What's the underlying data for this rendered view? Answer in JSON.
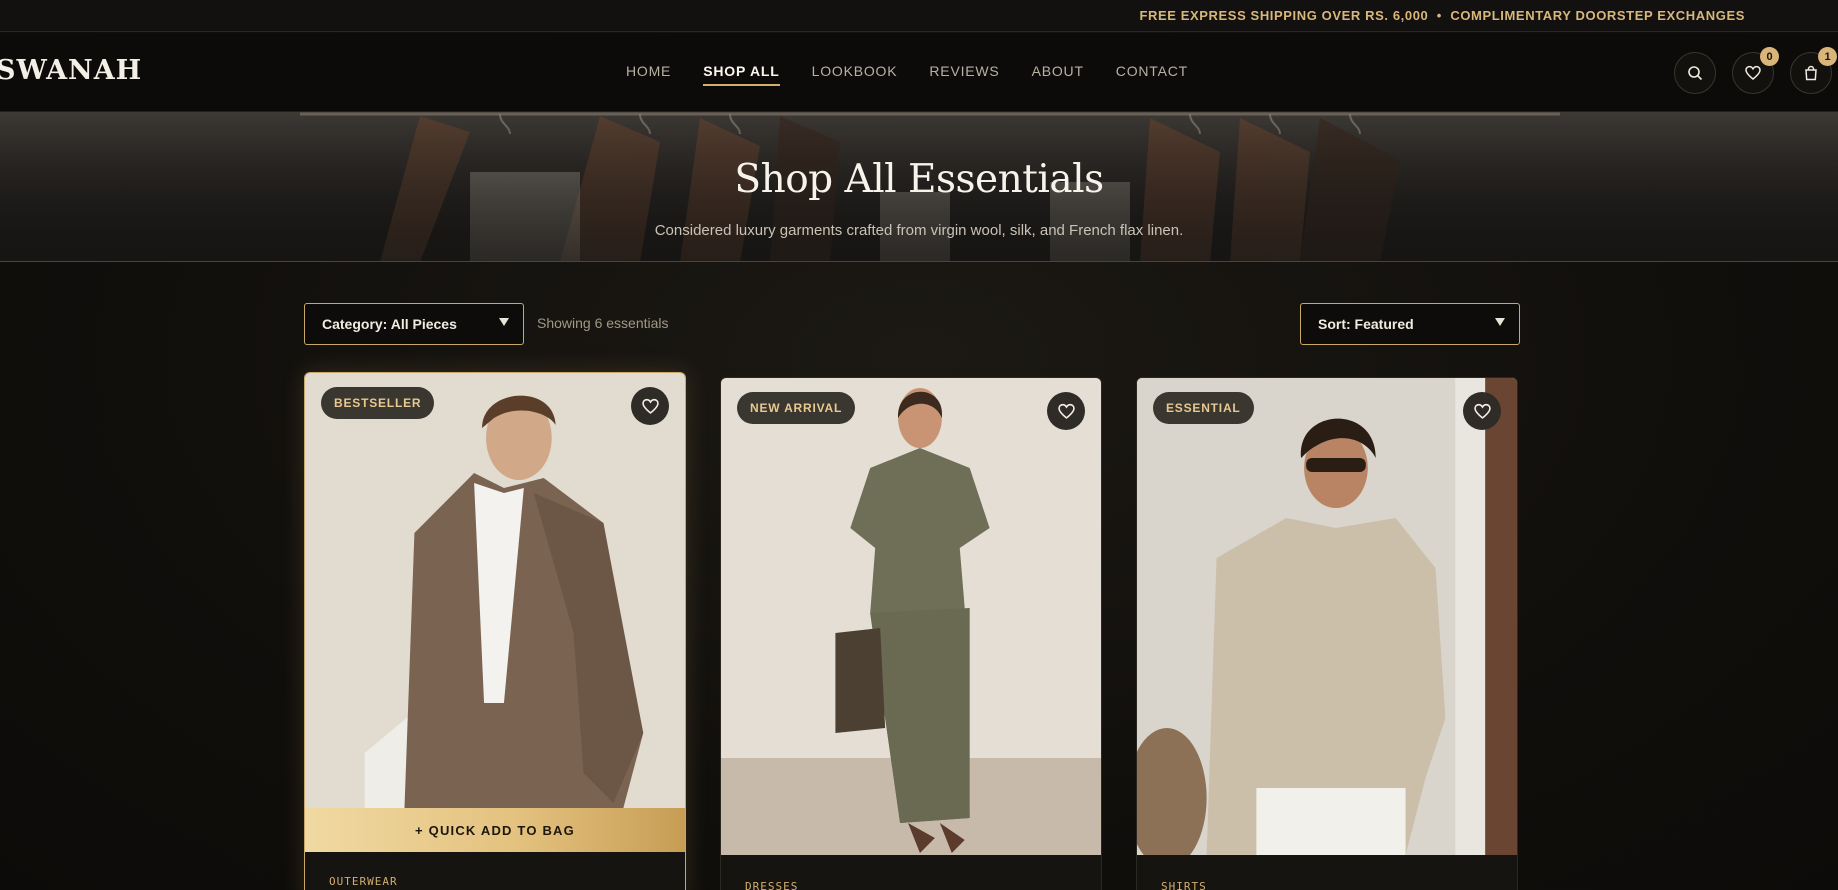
{
  "announcement": "FREE EXPRESS SHIPPING OVER RS. 6,000  •  COMPLIMENTARY DOORSTEP EXCHANGES",
  "header": {
    "logo": "SWANAH",
    "nav": [
      "HOME",
      "SHOP ALL",
      "LOOKBOOK",
      "REVIEWS",
      "ABOUT",
      "CONTACT"
    ],
    "active_nav": "SHOP ALL",
    "wishlist_count": "0",
    "cart_count": "1"
  },
  "hero": {
    "title": "Shop All Essentials",
    "subtitle": "Considered luxury garments crafted from virgin wool, silk, and French flax linen."
  },
  "toolbar": {
    "category_label": "Category: All Pieces",
    "count_text": "Showing 6 essentials",
    "sort_label": "Sort: Featured"
  },
  "products": [
    {
      "badge": "BESTSELLER",
      "category": "OUTERWEAR",
      "quick_add": "+ QUICK ADD TO BAG"
    },
    {
      "badge": "NEW ARRIVAL",
      "category": "DRESSES"
    },
    {
      "badge": "ESSENTIAL",
      "category": "SHIRTS"
    }
  ],
  "colors": {
    "accent": "#d4ae6c",
    "background": "#110f0c",
    "text": "#e9e4da"
  },
  "icons": [
    "search-icon",
    "heart-icon",
    "bag-icon",
    "chevron-down-icon"
  ]
}
